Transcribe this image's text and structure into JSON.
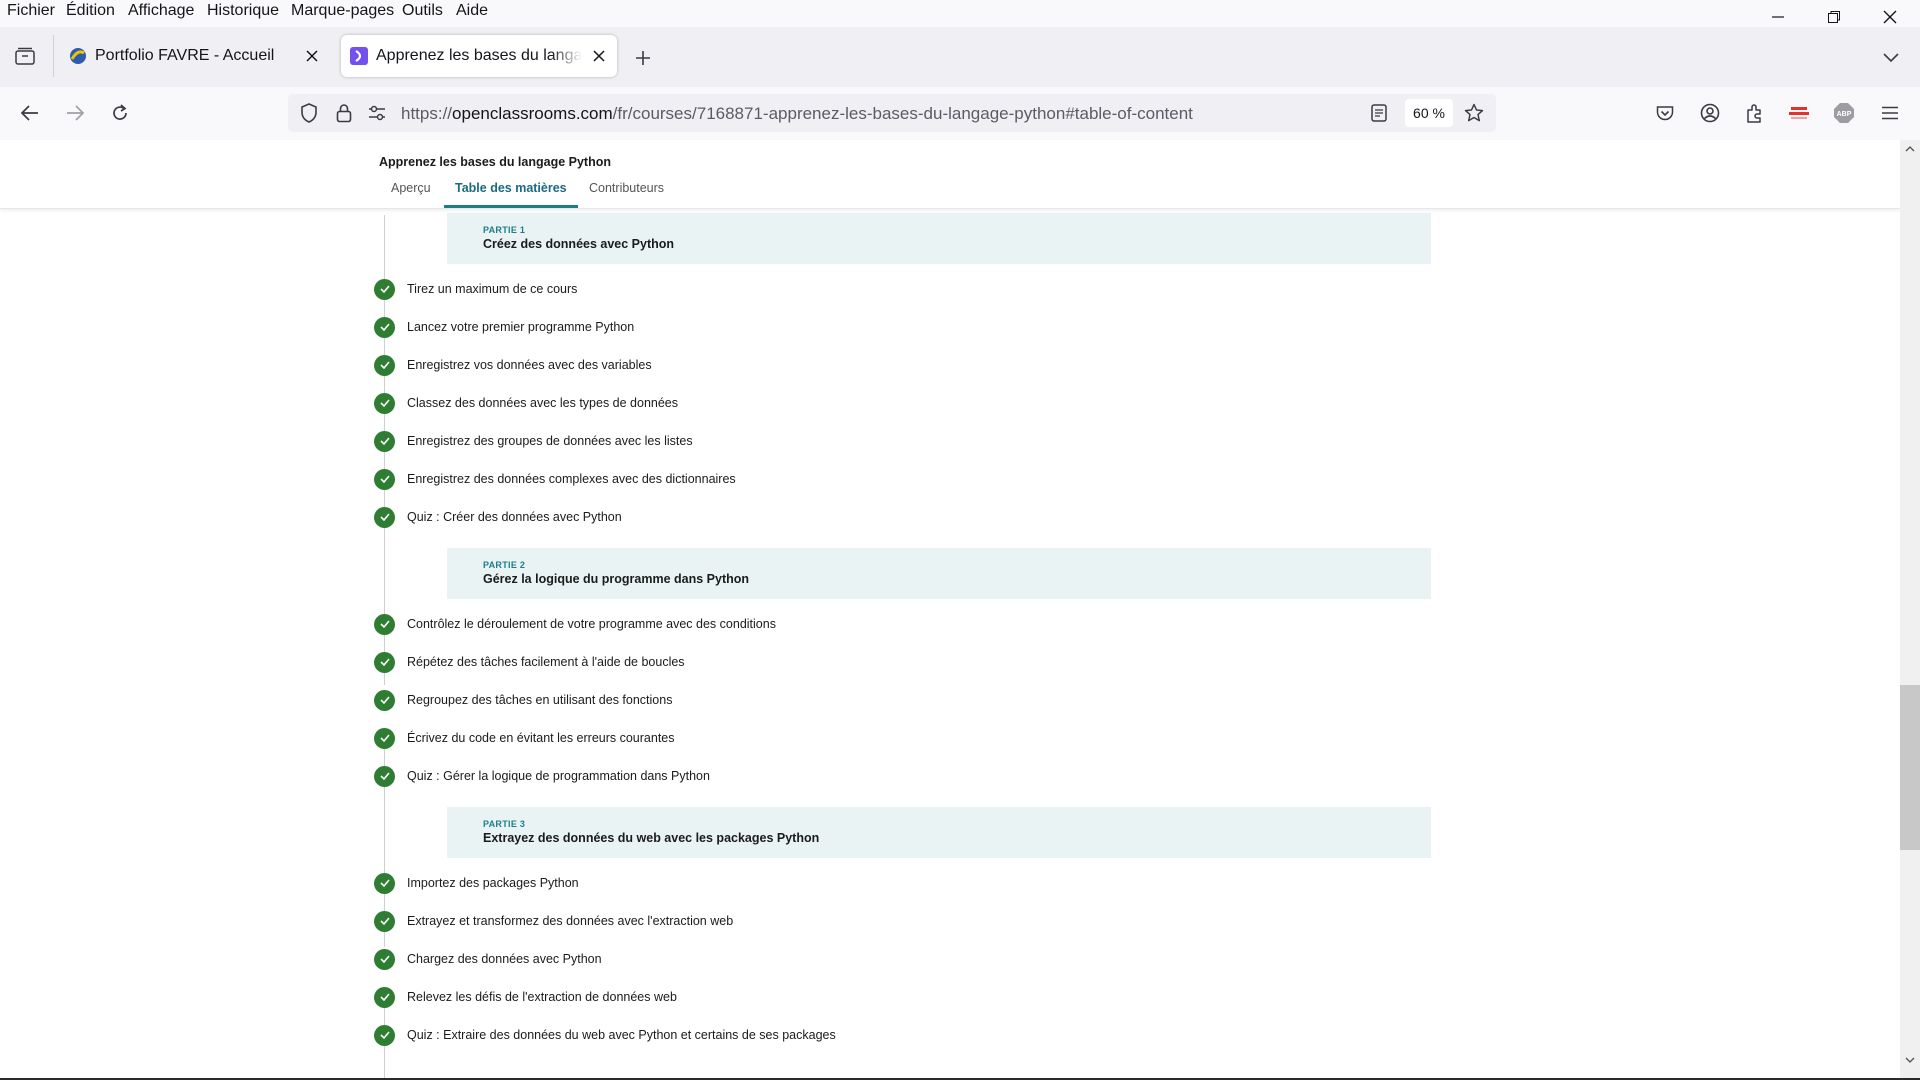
{
  "menu": {
    "items": [
      "Fichier",
      "Édition",
      "Affichage",
      "Historique",
      "Marque-pages",
      "Outils",
      "Aide"
    ]
  },
  "tabs": [
    {
      "title": "Portfolio FAVRE - Accueil",
      "icon": "portfolio-favicon"
    },
    {
      "title": "Apprenez les bases du langage",
      "icon": "openclassrooms-favicon",
      "active": true
    }
  ],
  "urlbar": {
    "prefix": "https://",
    "host": "openclassrooms.com",
    "path": "/fr/courses/7168871-apprenez-les-bases-du-langage-python#table-of-content",
    "zoom": "60 %"
  },
  "course": {
    "title": "Apprenez les bases du langage Python",
    "tabs": [
      "Aperçu",
      "Table des matières",
      "Contributeurs"
    ],
    "active_tab": "Table des matières"
  },
  "parts": [
    {
      "label": "PARTIE 1",
      "title": "Créez des données avec Python",
      "chapters": [
        "Tirez un maximum de ce cours",
        "Lancez votre premier programme Python",
        "Enregistrez vos données avec des variables",
        "Classez des données avec les types de données",
        "Enregistrez des groupes de données avec les listes",
        "Enregistrez des données complexes avec des dictionnaires",
        "Quiz : Créer des données avec Python"
      ]
    },
    {
      "label": "PARTIE 2",
      "title": "Gérez la logique du programme dans Python",
      "chapters": [
        "Contrôlez le déroulement de votre programme avec des conditions",
        "Répétez des tâches facilement à l'aide de boucles",
        "Regroupez des tâches en utilisant des fonctions",
        "Écrivez du code en évitant les erreurs courantes",
        "Quiz : Gérer la logique de programmation dans Python"
      ]
    },
    {
      "label": "PARTIE 3",
      "title": "Extrayez des données du web avec les packages Python",
      "chapters": [
        "Importez des packages Python",
        "Extrayez et transformez des données avec l'extraction web",
        "Chargez des données avec Python",
        "Relevez les défis de l'extraction de données web",
        "Quiz : Extraire des données du web avec Python et certains de ses packages"
      ]
    }
  ],
  "colors": {
    "check_green": "#2e7d32",
    "accent_teal": "#1f7d8a",
    "part_bg": "#e9f3f3"
  }
}
